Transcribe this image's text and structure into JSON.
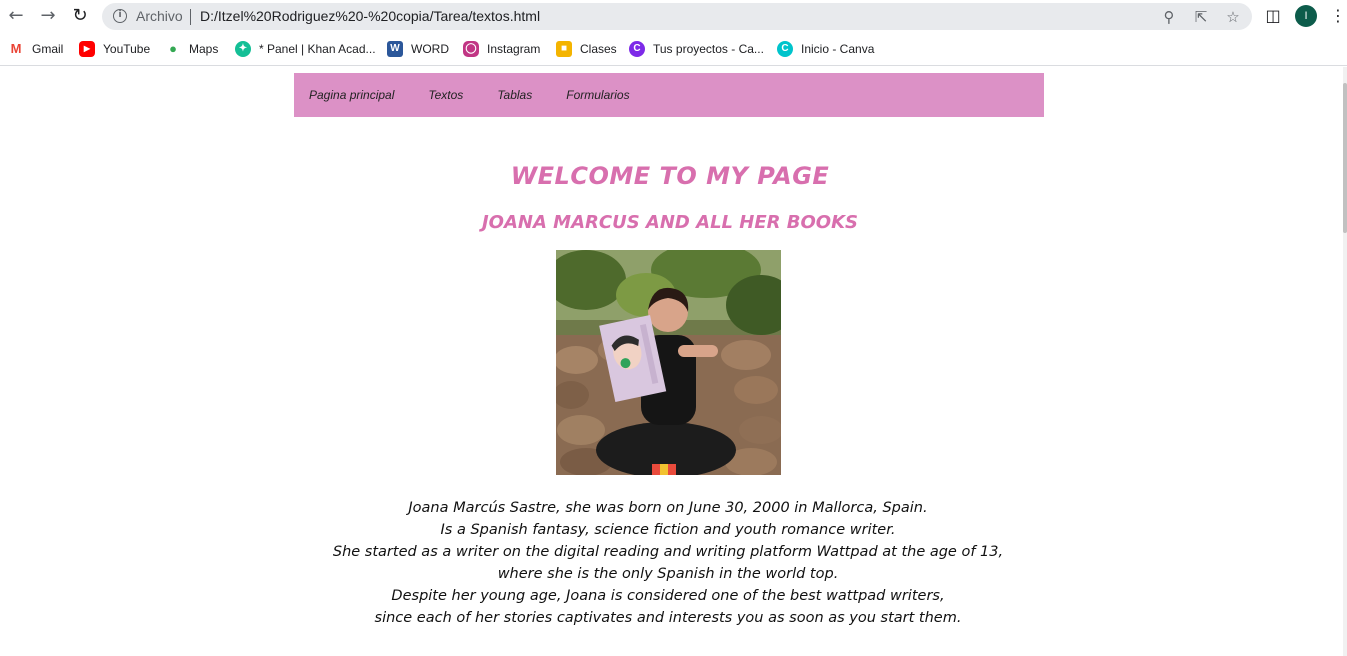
{
  "browser": {
    "back_icon": "arrow-left-icon",
    "forward_icon": "arrow-right-icon",
    "reload_icon": "reload-icon",
    "security_label": "Archivo",
    "url": "D:/Itzel%20Rodriguez%20-%20copia/Tarea/textos.html",
    "profile_initial": "I"
  },
  "bookmarks": [
    {
      "label": "Gmail",
      "icon": "gmail-icon",
      "color": "#ea4335"
    },
    {
      "label": "YouTube",
      "icon": "youtube-icon",
      "color": "#ff0000"
    },
    {
      "label": "Maps",
      "icon": "maps-icon",
      "color": "#34a853"
    },
    {
      "label": "* Panel | Khan Acad...",
      "icon": "khan-academy-icon",
      "color": "#14bf96"
    },
    {
      "label": "WORD",
      "icon": "word-icon",
      "color": "#2b579a"
    },
    {
      "label": "Instagram",
      "icon": "instagram-icon",
      "color": "#c13584"
    },
    {
      "label": "Clases",
      "icon": "classroom-icon",
      "color": "#f4b400"
    },
    {
      "label": "Tus proyectos - Ca...",
      "icon": "canva-icon",
      "color": "#7d2ae8"
    },
    {
      "label": "Inicio - Canva",
      "icon": "canva-icon",
      "color": "#00c4cc"
    }
  ],
  "page": {
    "menu": [
      "Pagina principal",
      "Textos",
      "Tablas",
      "Formularios"
    ],
    "menu_color": "#dc91c6",
    "title": "WELCOME TO MY PAGE",
    "subtitle": "JOANA MARCUS AND ALL HER BOOKS",
    "heading_color": "#d86fae",
    "bio": [
      "Joana Marcús Sastre, she was born on June 30, 2000 in Mallorca, Spain.",
      "Is a Spanish fantasy, science fiction and youth romance writer.",
      "She started as a writer on the digital reading and writing platform Wattpad at the age of 13,",
      "where she is the only Spanish in the world top.",
      "Despite her young age, Joana is considered one of the best wattpad writers,",
      "since each of her stories captivates and interests you as soon as you start them."
    ]
  }
}
